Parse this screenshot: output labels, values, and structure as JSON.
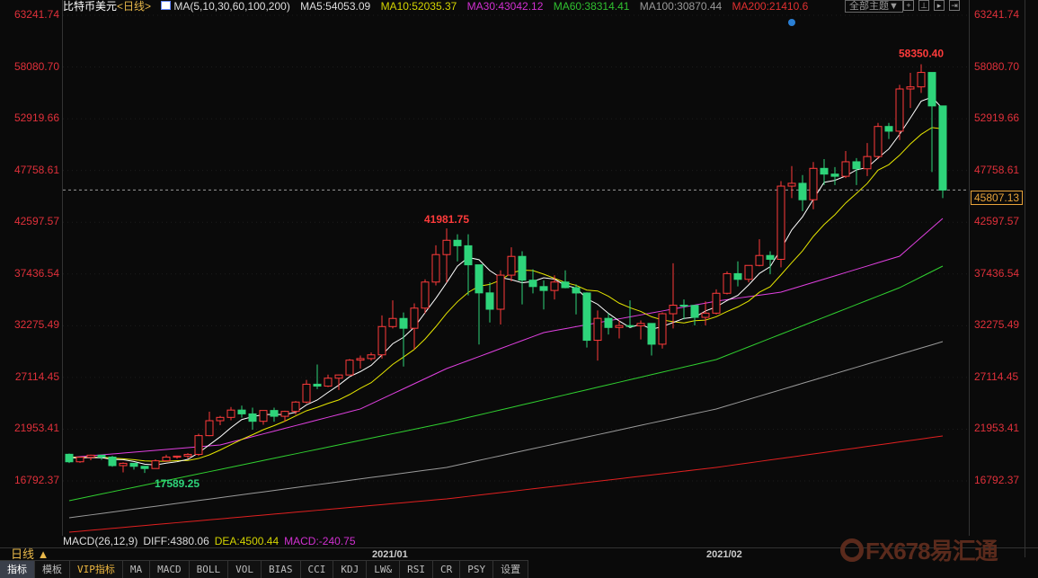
{
  "header": {
    "symbol": "比特币美元",
    "period": "<日线>",
    "ma_label": "MA(5,10,30,60,100,200)",
    "ma5": "MA5:54053.09",
    "ma10": "MA10:52035.37",
    "ma30": "MA30:43042.12",
    "ma60": "MA60:38314.41",
    "ma100": "MA100:30870.44",
    "ma200": "MA200:21410.6",
    "theme_button": "全部主题▼"
  },
  "colors": {
    "up": "#ff3b3b",
    "down": "#2ed47a",
    "ma5": "#ffffff",
    "ma10": "#e6e600",
    "ma30": "#e040e0",
    "ma60": "#30d030",
    "ma100": "#9a9a9a",
    "ma200": "#e02020"
  },
  "price_axis": [
    "63241.74",
    "58080.70",
    "52919.66",
    "47758.61",
    "42597.57",
    "37436.54",
    "32275.49",
    "27114.45",
    "21953.41",
    "16792.37"
  ],
  "current_price": "45807.13",
  "macd": {
    "label": "MACD(26,12,9)",
    "diff": "DIFF:4380.06",
    "dea": "DEA:4500.44",
    "macd": "MACD:-240.75"
  },
  "dates": [
    "2021/01",
    "2021/02"
  ],
  "day_button": "日线 ▲",
  "tabs": [
    "指标",
    "模板",
    "VIP指标",
    "MA",
    "MACD",
    "BOLL",
    "VOL",
    "BIAS",
    "CCI",
    "KDJ",
    "LW&",
    "RSI",
    "CR",
    "PSY",
    "设置"
  ],
  "watermark": "FX678易汇通",
  "chart_data": {
    "type": "candlestick",
    "title": "比特币美元 日线",
    "ylim": [
      16792.37,
      63241.74
    ],
    "annotations": {
      "high": "58350.40",
      "mid_high": "41981.75",
      "low": "17589.25"
    },
    "start_open": 19450,
    "ohlc_hlc": [
      [
        19530,
        18580,
        18700
      ],
      [
        19180,
        18600,
        19150
      ],
      [
        19420,
        18860,
        19360
      ],
      [
        19390,
        18900,
        19170
      ],
      [
        19290,
        18200,
        18320
      ],
      [
        18640,
        17650,
        18550
      ],
      [
        18560,
        17920,
        18250
      ],
      [
        18280,
        17589.25,
        18030
      ],
      [
        18950,
        18000,
        18800
      ],
      [
        19400,
        18720,
        19170
      ],
      [
        19320,
        19000,
        19270
      ],
      [
        19560,
        19050,
        19440
      ],
      [
        21500,
        19280,
        21310
      ],
      [
        23700,
        21250,
        22800
      ],
      [
        23280,
        22350,
        23130
      ],
      [
        24170,
        22850,
        23860
      ],
      [
        24300,
        23100,
        23480
      ],
      [
        24100,
        21900,
        22740
      ],
      [
        23830,
        22400,
        23820
      ],
      [
        24100,
        22700,
        23240
      ],
      [
        23800,
        22700,
        23730
      ],
      [
        24760,
        23420,
        24660
      ],
      [
        26870,
        24530,
        26440
      ],
      [
        28400,
        25950,
        26250
      ],
      [
        27400,
        26150,
        27040
      ],
      [
        27400,
        25860,
        27360
      ],
      [
        28950,
        27340,
        28840
      ],
      [
        29300,
        28000,
        29000
      ],
      [
        29600,
        28800,
        29370
      ],
      [
        33300,
        29000,
        32190
      ],
      [
        34800,
        32000,
        33000
      ],
      [
        33600,
        28200,
        32020
      ],
      [
        34500,
        29900,
        34030
      ],
      [
        36900,
        33500,
        36630
      ],
      [
        40300,
        36300,
        39370
      ],
      [
        41981.75,
        36600,
        40800
      ],
      [
        41400,
        38700,
        40250
      ],
      [
        41400,
        35300,
        38350
      ],
      [
        38300,
        30400,
        35550
      ],
      [
        36600,
        32600,
        33920
      ],
      [
        37800,
        32400,
        37320
      ],
      [
        40100,
        36700,
        39190
      ],
      [
        39700,
        34400,
        36820
      ],
      [
        37900,
        35500,
        36180
      ],
      [
        36800,
        33900,
        35790
      ],
      [
        37300,
        34900,
        36630
      ],
      [
        37800,
        36000,
        36070
      ],
      [
        36400,
        33400,
        35540
      ],
      [
        35600,
        30100,
        30820
      ],
      [
        33800,
        28800,
        33010
      ],
      [
        33500,
        31400,
        32100
      ],
      [
        32800,
        31000,
        32290
      ],
      [
        34800,
        32100,
        32260
      ],
      [
        32800,
        30900,
        32500
      ],
      [
        32500,
        29300,
        30430
      ],
      [
        33600,
        30000,
        33470
      ],
      [
        38500,
        32000,
        34320
      ],
      [
        34900,
        32900,
        34300
      ],
      [
        34300,
        32300,
        33110
      ],
      [
        34700,
        32300,
        33530
      ],
      [
        35900,
        33400,
        35510
      ],
      [
        37700,
        35400,
        37470
      ],
      [
        38700,
        36200,
        36900
      ],
      [
        38300,
        36600,
        38290
      ],
      [
        40900,
        38200,
        39280
      ],
      [
        39700,
        37400,
        38900
      ],
      [
        46700,
        38100,
        46200
      ],
      [
        48200,
        45000,
        46480
      ],
      [
        47300,
        43700,
        44840
      ],
      [
        48600,
        43900,
        47970
      ],
      [
        48900,
        46300,
        47400
      ],
      [
        48100,
        46300,
        47180
      ],
      [
        49700,
        47000,
        48630
      ],
      [
        49000,
        46300,
        47930
      ],
      [
        50500,
        47200,
        49150
      ],
      [
        52500,
        48900,
        52150
      ],
      [
        52500,
        50900,
        51680
      ],
      [
        56300,
        50800,
        55890
      ],
      [
        57500,
        54000,
        56100
      ],
      [
        58350.4,
        55500,
        57540
      ],
      [
        57500,
        47600,
        54200
      ],
      [
        54200,
        45000,
        45807.13
      ]
    ],
    "ma_long": {
      "ma30": [
        [
          0,
          19125
        ],
        [
          14,
          20380
        ],
        [
          27,
          23970
        ],
        [
          35,
          28000
        ],
        [
          44,
          31590
        ],
        [
          60,
          34725
        ],
        [
          66,
          35620
        ],
        [
          77,
          39210
        ],
        [
          81,
          42975
        ]
      ],
      "ma60": [
        [
          0,
          14820
        ],
        [
          35,
          22620
        ],
        [
          60,
          28900
        ],
        [
          77,
          36070
        ],
        [
          81,
          38224
        ]
      ],
      "ma100": [
        [
          0,
          13115
        ],
        [
          35,
          18140
        ],
        [
          60,
          23970
        ],
        [
          81,
          30690
        ]
      ],
      "ma200": [
        [
          0,
          11680
        ],
        [
          35,
          15000
        ],
        [
          60,
          18140
        ],
        [
          81,
          21275
        ]
      ]
    }
  }
}
